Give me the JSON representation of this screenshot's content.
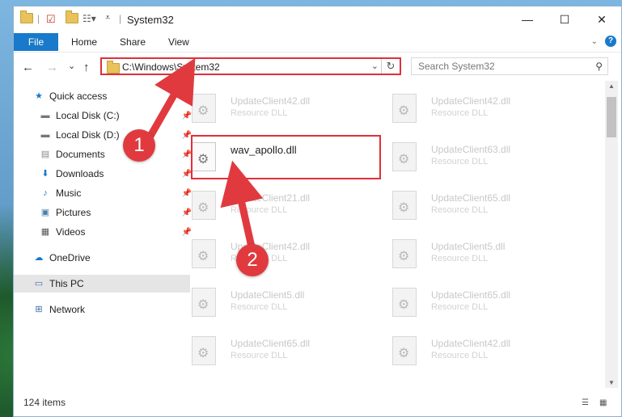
{
  "window": {
    "title": "System32",
    "controls": {
      "minimize": "—",
      "maximize": "☐",
      "close": "✕"
    }
  },
  "quick_access_toolbar": {
    "icons": [
      "folder-icon",
      "properties-icon",
      "new-folder-icon",
      "customize-icon"
    ]
  },
  "ribbon": {
    "file_tab": "File",
    "tabs": [
      "Home",
      "Share",
      "View"
    ],
    "help": "?"
  },
  "nav": {
    "back": "←",
    "forward": "→",
    "recent": "⌄",
    "up": "↑",
    "address": "C:\\Windows\\System32",
    "refresh": "↻",
    "search_placeholder": "Search System32"
  },
  "sidebar": {
    "items": [
      {
        "label": "Quick access",
        "icon": "star-icon",
        "pinned": false
      },
      {
        "label": "Local Disk (C:)",
        "icon": "drive-icon",
        "pinned": true
      },
      {
        "label": "Local Disk (D:)",
        "icon": "drive-icon",
        "pinned": true
      },
      {
        "label": "Documents",
        "icon": "documents-icon",
        "pinned": true
      },
      {
        "label": "Downloads",
        "icon": "downloads-icon",
        "pinned": true
      },
      {
        "label": "Music",
        "icon": "music-icon",
        "pinned": true
      },
      {
        "label": "Pictures",
        "icon": "pictures-icon",
        "pinned": true
      },
      {
        "label": "Videos",
        "icon": "videos-icon",
        "pinned": true
      },
      {
        "label": "OneDrive",
        "icon": "cloud-icon",
        "pinned": false
      },
      {
        "label": "This PC",
        "icon": "computer-icon",
        "pinned": false,
        "selected": true
      },
      {
        "label": "Network",
        "icon": "network-icon",
        "pinned": false
      }
    ]
  },
  "files": {
    "left": [
      {
        "name": "UpdateClient42.dll",
        "type": "Resource DLL"
      },
      {
        "name": "wav_apollo.dll",
        "type": "",
        "highlighted": true
      },
      {
        "name": "UpdateClient21.dll",
        "type": "Resource DLL"
      },
      {
        "name": "UpdateClient42.dll",
        "type": "Resource DLL"
      },
      {
        "name": "UpdateClient5.dll",
        "type": "Resource DLL"
      },
      {
        "name": "UpdateClient65.dll",
        "type": "Resource DLL"
      }
    ],
    "right": [
      {
        "name": "UpdateClient42.dll",
        "type": "Resource DLL"
      },
      {
        "name": "UpdateClient63.dll",
        "type": "Resource DLL"
      },
      {
        "name": "UpdateClient65.dll",
        "type": "Resource DLL"
      },
      {
        "name": "UpdateClient5.dll",
        "type": "Resource DLL"
      },
      {
        "name": "UpdateClient65.dll",
        "type": "Resource DLL"
      },
      {
        "name": "UpdateClient42.dll",
        "type": "Resource DLL"
      }
    ]
  },
  "status": {
    "count": "124 items"
  },
  "annotations": {
    "badge1": "1",
    "badge2": "2",
    "color": "#e03a3f"
  }
}
